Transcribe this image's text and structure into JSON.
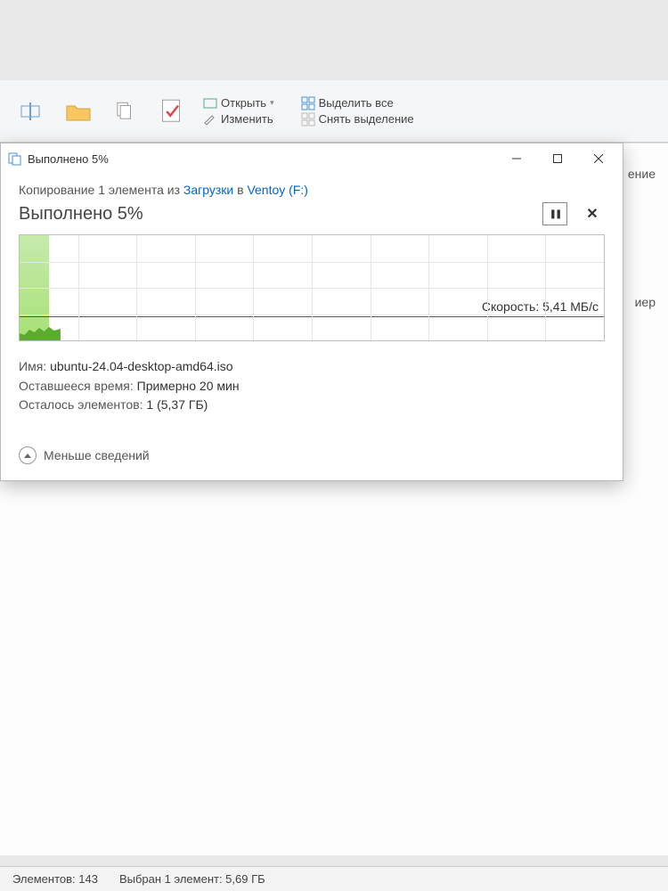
{
  "ribbon": {
    "open": "Открыть",
    "edit": "Изменить",
    "select_all": "Выделить все",
    "deselect": "Снять выделение"
  },
  "bg_fragments": {
    "f1": "ение",
    "f2": "иер"
  },
  "dialog": {
    "title": "Выполнено 5%",
    "op_prefix": "Копирование 1 элемента из ",
    "op_src": "Загрузки",
    "op_mid": " в ",
    "op_dst": "Ventoy (F:)",
    "status": "Выполнено 5%",
    "speed_label": "Скорость: 5,41 МБ/c",
    "name_lbl": "Имя:",
    "name_val": "ubuntu-24.04-desktop-amd64.iso",
    "time_lbl": "Оставшееся время:",
    "time_val": "Примерно 20 мин",
    "remain_lbl": "Осталось элементов:",
    "remain_val": "1 (5,37 ГБ)",
    "toggle": "Меньше сведений",
    "pause_glyph": "❚❚"
  },
  "statusbar": {
    "count": "Элементов: 143",
    "selected": "Выбран 1 элемент: 5,69 ГБ"
  },
  "chart_data": {
    "type": "area",
    "progress_pct": 5,
    "speed_line_fraction": 0.78,
    "speed_text": "5,41 МБ/c",
    "cols": 10,
    "rows": 4
  }
}
